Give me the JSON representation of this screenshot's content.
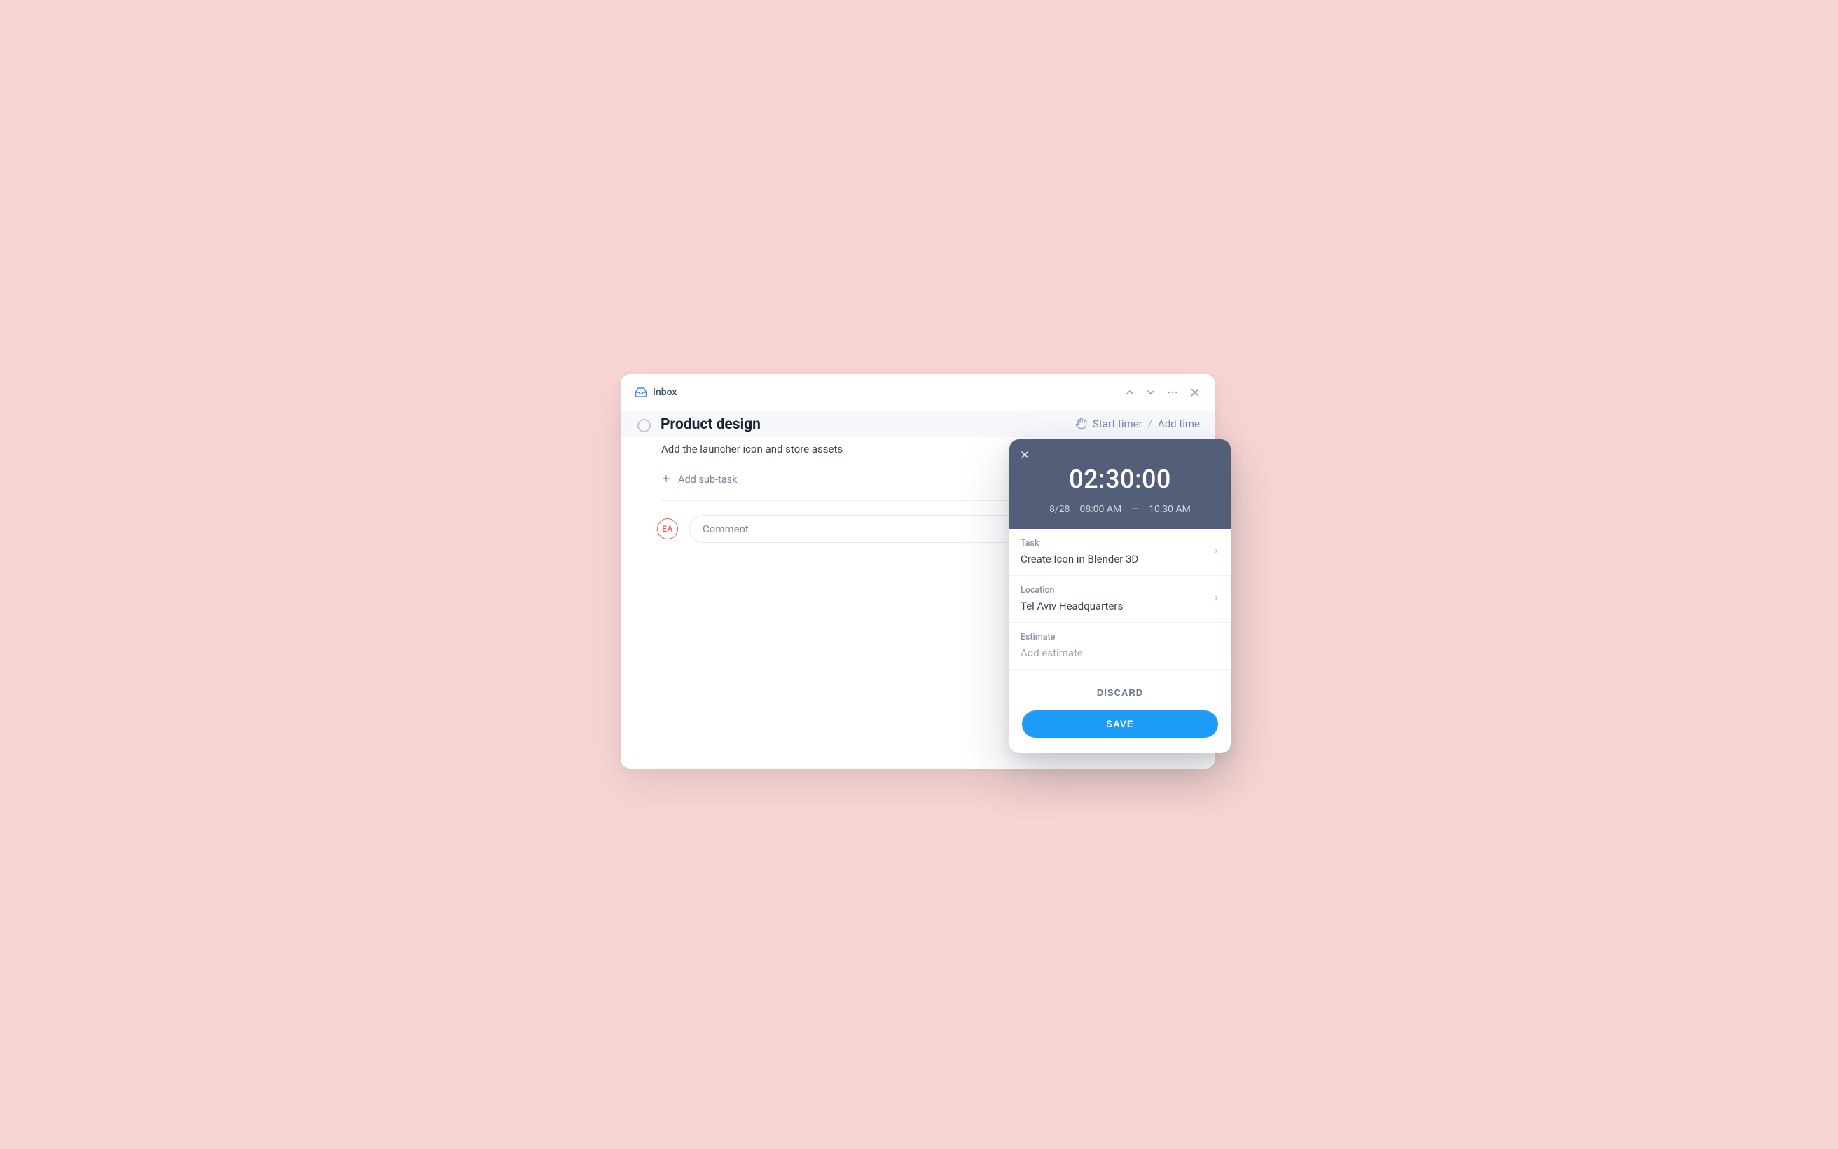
{
  "header": {
    "inbox_label": "Inbox"
  },
  "timer_bar": {
    "start_timer": "Start timer",
    "add_time": "Add time",
    "separator": "/"
  },
  "task": {
    "title": "Product design",
    "description": "Add the launcher icon and store assets",
    "add_subtask": "Add sub-task"
  },
  "comment": {
    "avatar_initials": "EA",
    "placeholder": "Comment"
  },
  "time_panel": {
    "duration": "02:30:00",
    "date": "8/28",
    "start": "08:00 AM",
    "end": "10:30 AM",
    "dash": "—",
    "sections": {
      "task": {
        "label": "Task",
        "value": "Create Icon in Blender 3D"
      },
      "location": {
        "label": "Location",
        "value": "Tel Aviv Headquarters"
      },
      "estimate": {
        "label": "Estimate",
        "placeholder": "Add estimate"
      }
    },
    "discard": "DISCARD",
    "save": "SAVE"
  }
}
